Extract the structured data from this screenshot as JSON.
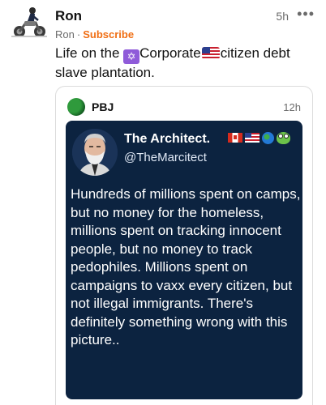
{
  "post": {
    "author": "Ron",
    "time": "5h",
    "more_label": "•••",
    "sub_author": "Ron",
    "separator": "·",
    "subscribe_label": "Subscribe",
    "text_part1": "Life on the ",
    "emoji1": "star-of-david-emoji",
    "text_part2": "Corporate",
    "emoji2": "us-flag-emoji",
    "text_part3": "citizen debt slave plantation.",
    "accent_color": "#f06f15"
  },
  "quote": {
    "author": "PBJ",
    "time": "12h",
    "tweet": {
      "name": "The Architect.",
      "handle": "@TheMarcitect",
      "name_emojis": [
        "canada-flag-emoji",
        "us-flag-emoji",
        "globe-emoji",
        "frog-emoji"
      ],
      "text": "Hundreds of millions spent on camps, but no money for the homeless, millions spent on tracking innocent people, but no money to track pedophiles. Millions spent on campaigns to vaxx every citizen, but not illegal immigrants. There's definitely something wrong with this picture..",
      "background": "#0c2340"
    }
  }
}
